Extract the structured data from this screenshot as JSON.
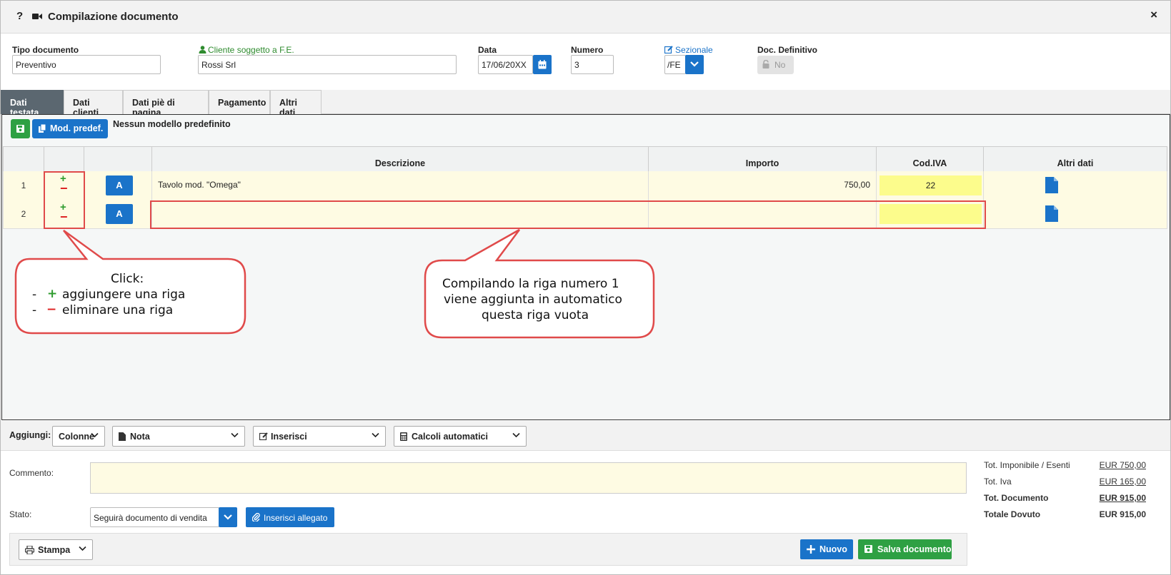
{
  "header": {
    "help": "?",
    "title": "Compilazione documento",
    "close": "×"
  },
  "fields": {
    "tipo_label": "Tipo documento",
    "tipo_value": "Preventivo",
    "cliente_label": "Cliente soggetto a F.E.",
    "cliente_value": "Rossi Srl",
    "data_label": "Data",
    "data_value": "17/06/20XX",
    "numero_label": "Numero",
    "numero_value": "3",
    "sezionale_label": "Sezionale",
    "sezionale_value": "/FE",
    "definitivo_label": "Doc. Definitivo",
    "definitivo_value": "No"
  },
  "tabs": [
    {
      "label": "Dati testata"
    },
    {
      "label": "Dati clienti"
    },
    {
      "label": "Dati piè di pagina"
    },
    {
      "label": "Pagamento"
    },
    {
      "label": "Altri dati"
    }
  ],
  "toolbar": {
    "mod_label": "Mod. predef.",
    "no_model_text": "Nessun modello predefinito"
  },
  "grid": {
    "columns": [
      "Descrizione",
      "Importo",
      "Cod.IVA",
      "Altri dati"
    ],
    "rows": [
      {
        "num": "1",
        "plus": "+",
        "minus": "−",
        "a": "A",
        "descrizione": "Tavolo mod. \"Omega\"",
        "importo": "750,00",
        "iva": "22"
      },
      {
        "num": "2",
        "plus": "+",
        "minus": "−",
        "a": "A",
        "descrizione": "",
        "importo": "",
        "iva": ""
      }
    ]
  },
  "callouts": {
    "left_title": "Click:",
    "left_line1_prefix": "-",
    "left_line1_sign": "+",
    "left_line1": "aggiungere una riga",
    "left_line2_prefix": "-",
    "left_line2_sign": "−",
    "left_line2": "eliminare una riga",
    "right_line1": "Compilando la riga numero 1",
    "right_line2": "viene aggiunta in automatico",
    "right_line3": "questa riga vuota"
  },
  "addbar": {
    "label": "Aggiungi:",
    "colonne": "Colonne",
    "nota": "Nota",
    "inserisci": "Inserisci",
    "calcoli": "Calcoli automatici"
  },
  "lower": {
    "commento_label": "Commento:",
    "stato_label": "Stato:",
    "stato_value": "Seguirà documento di vendita",
    "allegato_label": "Inserisci allegato"
  },
  "totals": [
    {
      "label": "Tot. Imponibile / Esenti",
      "value": "EUR 750,00",
      "bold": false
    },
    {
      "label": "Tot. Iva",
      "value": "EUR 165,00",
      "bold": false
    },
    {
      "label": "Tot. Documento",
      "value": "EUR 915,00",
      "bold": true
    },
    {
      "label": "Totale Dovuto",
      "value": "EUR 915,00",
      "bold": true
    }
  ],
  "footer": {
    "stampa": "Stampa",
    "nuovo": "Nuovo",
    "salva": "Salva documento"
  },
  "colors": {
    "primary_blue": "#1a73c9",
    "green": "#2ea043",
    "active_tab": "#5b6770",
    "row_yellow": "#fefbe3",
    "iva_yellow": "#fcfc8c",
    "highlight_red": "#e04a4a"
  }
}
